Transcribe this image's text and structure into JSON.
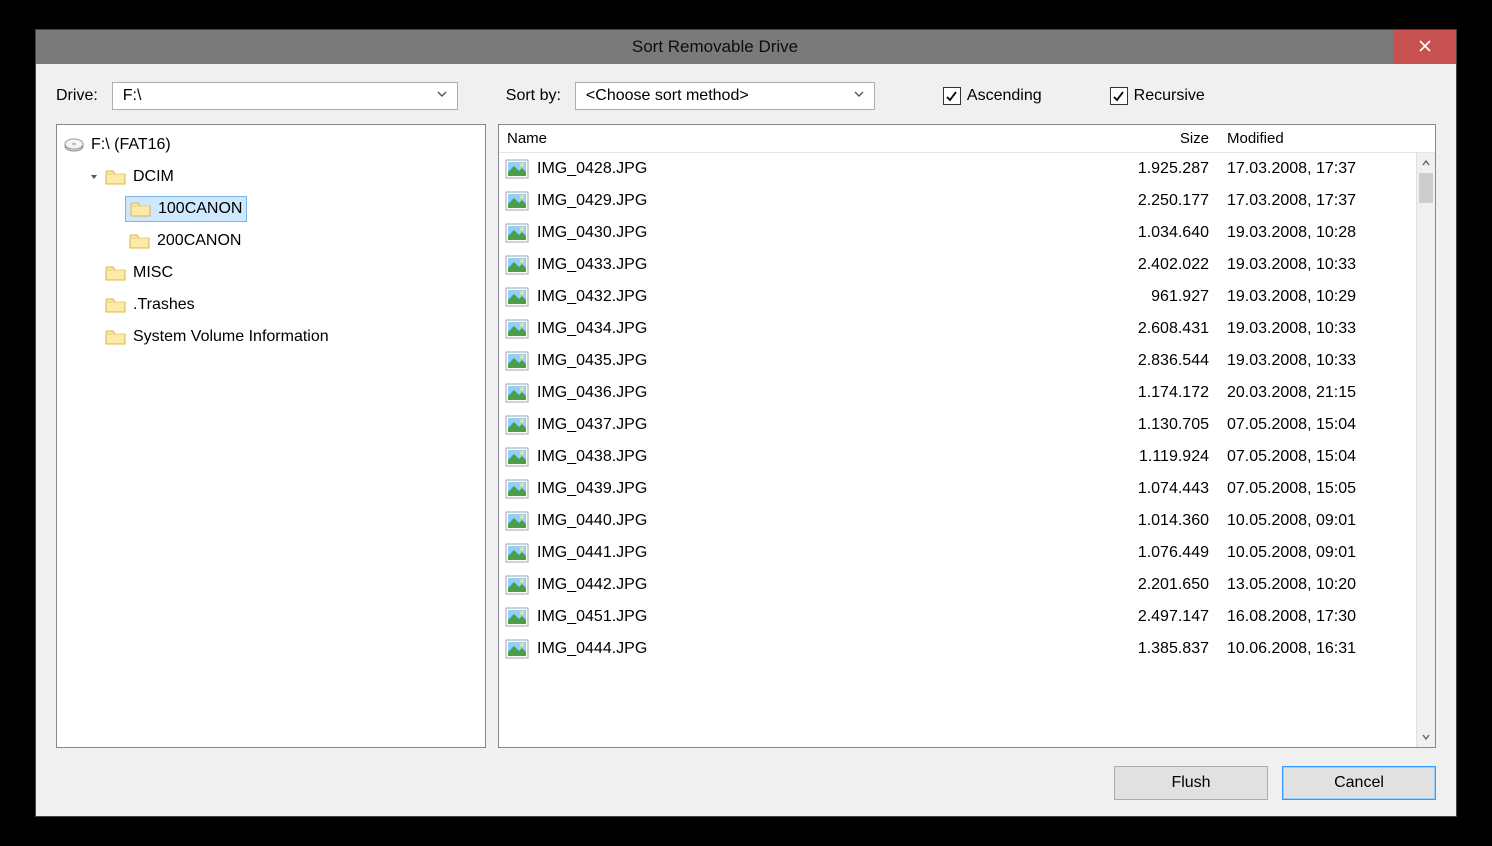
{
  "title": "Sort Removable Drive",
  "drive_label": "Drive:",
  "drive_value": "F:\\",
  "sortby_label": "Sort by:",
  "sortby_value": "<Choose sort method>",
  "ascending_label": "Ascending",
  "ascending_checked": true,
  "recursive_label": "Recursive",
  "recursive_checked": true,
  "tree": {
    "root": "F:\\ (FAT16)",
    "items": [
      {
        "label": "DCIM",
        "depth": 1,
        "expanded": true,
        "hasChildren": true
      },
      {
        "label": "100CANON",
        "depth": 2,
        "selected": true
      },
      {
        "label": "200CANON",
        "depth": 2
      },
      {
        "label": "MISC",
        "depth": 1
      },
      {
        "label": ".Trashes",
        "depth": 1
      },
      {
        "label": "System Volume Information",
        "depth": 1
      }
    ]
  },
  "columns": {
    "name": "Name",
    "size": "Size",
    "modified": "Modified"
  },
  "files": [
    {
      "name": "IMG_0428.JPG",
      "size": "1.925.287",
      "modified": "17.03.2008, 17:37"
    },
    {
      "name": "IMG_0429.JPG",
      "size": "2.250.177",
      "modified": "17.03.2008, 17:37"
    },
    {
      "name": "IMG_0430.JPG",
      "size": "1.034.640",
      "modified": "19.03.2008, 10:28"
    },
    {
      "name": "IMG_0433.JPG",
      "size": "2.402.022",
      "modified": "19.03.2008, 10:33"
    },
    {
      "name": "IMG_0432.JPG",
      "size": "961.927",
      "modified": "19.03.2008, 10:29"
    },
    {
      "name": "IMG_0434.JPG",
      "size": "2.608.431",
      "modified": "19.03.2008, 10:33"
    },
    {
      "name": "IMG_0435.JPG",
      "size": "2.836.544",
      "modified": "19.03.2008, 10:33"
    },
    {
      "name": "IMG_0436.JPG",
      "size": "1.174.172",
      "modified": "20.03.2008, 21:15"
    },
    {
      "name": "IMG_0437.JPG",
      "size": "1.130.705",
      "modified": "07.05.2008, 15:04"
    },
    {
      "name": "IMG_0438.JPG",
      "size": "1.119.924",
      "modified": "07.05.2008, 15:04"
    },
    {
      "name": "IMG_0439.JPG",
      "size": "1.074.443",
      "modified": "07.05.2008, 15:05"
    },
    {
      "name": "IMG_0440.JPG",
      "size": "1.014.360",
      "modified": "10.05.2008, 09:01"
    },
    {
      "name": "IMG_0441.JPG",
      "size": "1.076.449",
      "modified": "10.05.2008, 09:01"
    },
    {
      "name": "IMG_0442.JPG",
      "size": "2.201.650",
      "modified": "13.05.2008, 10:20"
    },
    {
      "name": "IMG_0451.JPG",
      "size": "2.497.147",
      "modified": "16.08.2008, 17:30"
    },
    {
      "name": "IMG_0444.JPG",
      "size": "1.385.837",
      "modified": "10.06.2008, 16:31"
    }
  ],
  "buttons": {
    "flush": "Flush",
    "cancel": "Cancel"
  }
}
